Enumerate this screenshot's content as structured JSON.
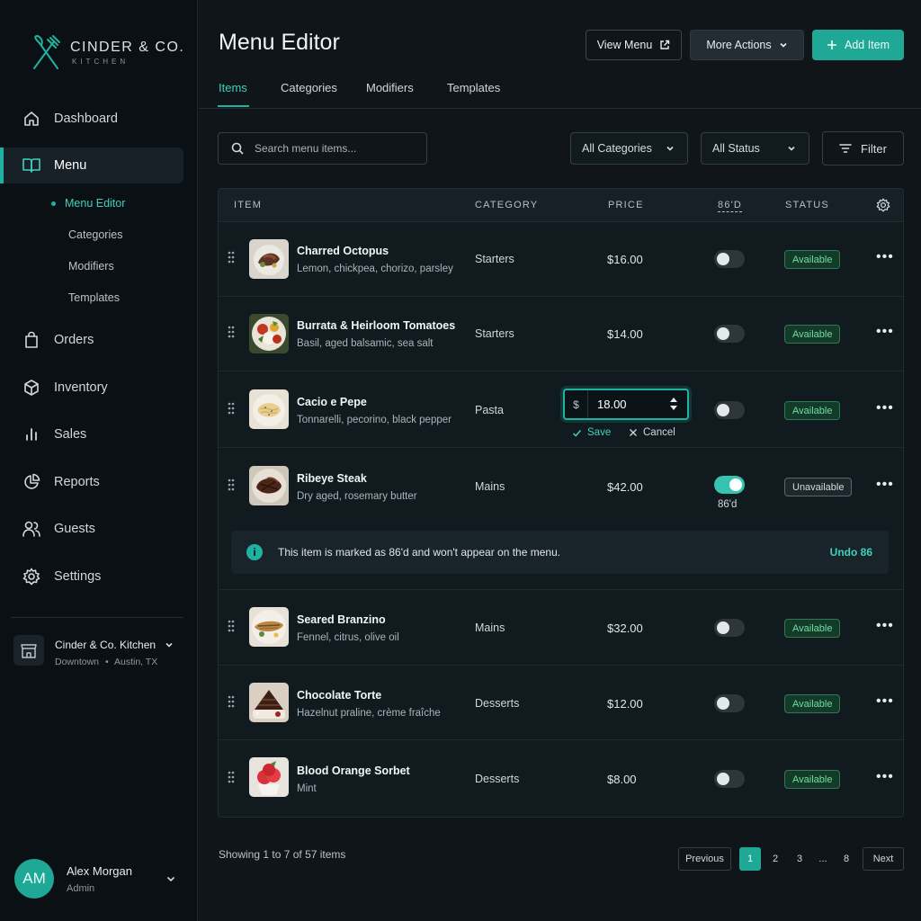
{
  "brand": {
    "name": "CINDER & CO.",
    "sub": "KITCHEN"
  },
  "sidebar": {
    "items": [
      {
        "label": "Dashboard",
        "icon": "home-icon"
      },
      {
        "label": "Menu",
        "icon": "book-icon"
      },
      {
        "label": "Orders",
        "icon": "shopping-bag-icon"
      },
      {
        "label": "Inventory",
        "icon": "box-icon"
      },
      {
        "label": "Sales",
        "icon": "bar-chart-icon"
      },
      {
        "label": "Reports",
        "icon": "pie-chart-icon"
      },
      {
        "label": "Guests",
        "icon": "users-icon"
      },
      {
        "label": "Settings",
        "icon": "gear-icon"
      }
    ],
    "subitems": [
      "Menu Editor",
      "Categories",
      "Modifiers",
      "Templates"
    ]
  },
  "location": {
    "name": "Cinder & Co. Kitchen",
    "area": "Downtown",
    "city": "Austin, TX"
  },
  "user": {
    "initials": "AM",
    "name": "Alex Morgan",
    "role": "Admin"
  },
  "header": {
    "title": "Menu Editor",
    "view_menu": "View Menu",
    "more_actions": "More Actions",
    "add_item": "Add Item"
  },
  "tabs": [
    "Items",
    "Categories",
    "Modifiers",
    "Templates"
  ],
  "toolbar": {
    "search_placeholder": "Search menu items...",
    "category_filter": "All Categories",
    "status_filter": "All Status",
    "filter_label": "Filter"
  },
  "table": {
    "headers": {
      "item": "ITEM",
      "category": "CATEGORY",
      "price": "PRICE",
      "eighty_six": "86'D",
      "status": "STATUS"
    },
    "rows": [
      {
        "name": "Charred Octopus",
        "desc": "Lemon, chickpea, chorizo, parsley",
        "category": "Starters",
        "price": "$16.00",
        "eighty_six": false,
        "status": "Available"
      },
      {
        "name": "Burrata & Heirloom Tomatoes",
        "desc": "Basil, aged balsamic, sea salt",
        "category": "Starters",
        "price": "$14.00",
        "eighty_six": false,
        "status": "Available"
      },
      {
        "name": "Cacio e Pepe",
        "desc": "Tonnarelli, pecorino, black pepper",
        "category": "Pasta",
        "price_prefix": "$",
        "price_input": "18.00",
        "save": "Save",
        "cancel": "Cancel",
        "eighty_six": false,
        "status": "Available"
      },
      {
        "name": "Ribeye Steak",
        "desc": "Dry aged, rosemary butter",
        "category": "Mains",
        "price": "$42.00",
        "eighty_six": true,
        "eighty_six_label": "86'd",
        "status": "Unavailable",
        "notice": "This item is marked as 86'd and won't appear on the menu.",
        "notice_action": "Undo 86"
      },
      {
        "name": "Seared Branzino",
        "desc": "Fennel, citrus, olive oil",
        "category": "Mains",
        "price": "$32.00",
        "eighty_six": false,
        "status": "Available"
      },
      {
        "name": "Chocolate Torte",
        "desc": "Hazelnut praline, crème fraîche",
        "category": "Desserts",
        "price": "$12.00",
        "eighty_six": false,
        "status": "Available"
      },
      {
        "name": "Blood Orange Sorbet",
        "desc": "Mint",
        "category": "Desserts",
        "price": "$8.00",
        "eighty_six": false,
        "status": "Available"
      }
    ]
  },
  "pagination": {
    "info": "Showing 1 to 7 of 57 items",
    "previous": "Previous",
    "pages": [
      "1",
      "2",
      "3",
      "...",
      "8"
    ],
    "current": "1",
    "next": "Next"
  },
  "colors": {
    "accent": "#20b2a0",
    "background": "#0f1519",
    "sidebar": "#0b1014",
    "available": "#6fe0a0"
  }
}
